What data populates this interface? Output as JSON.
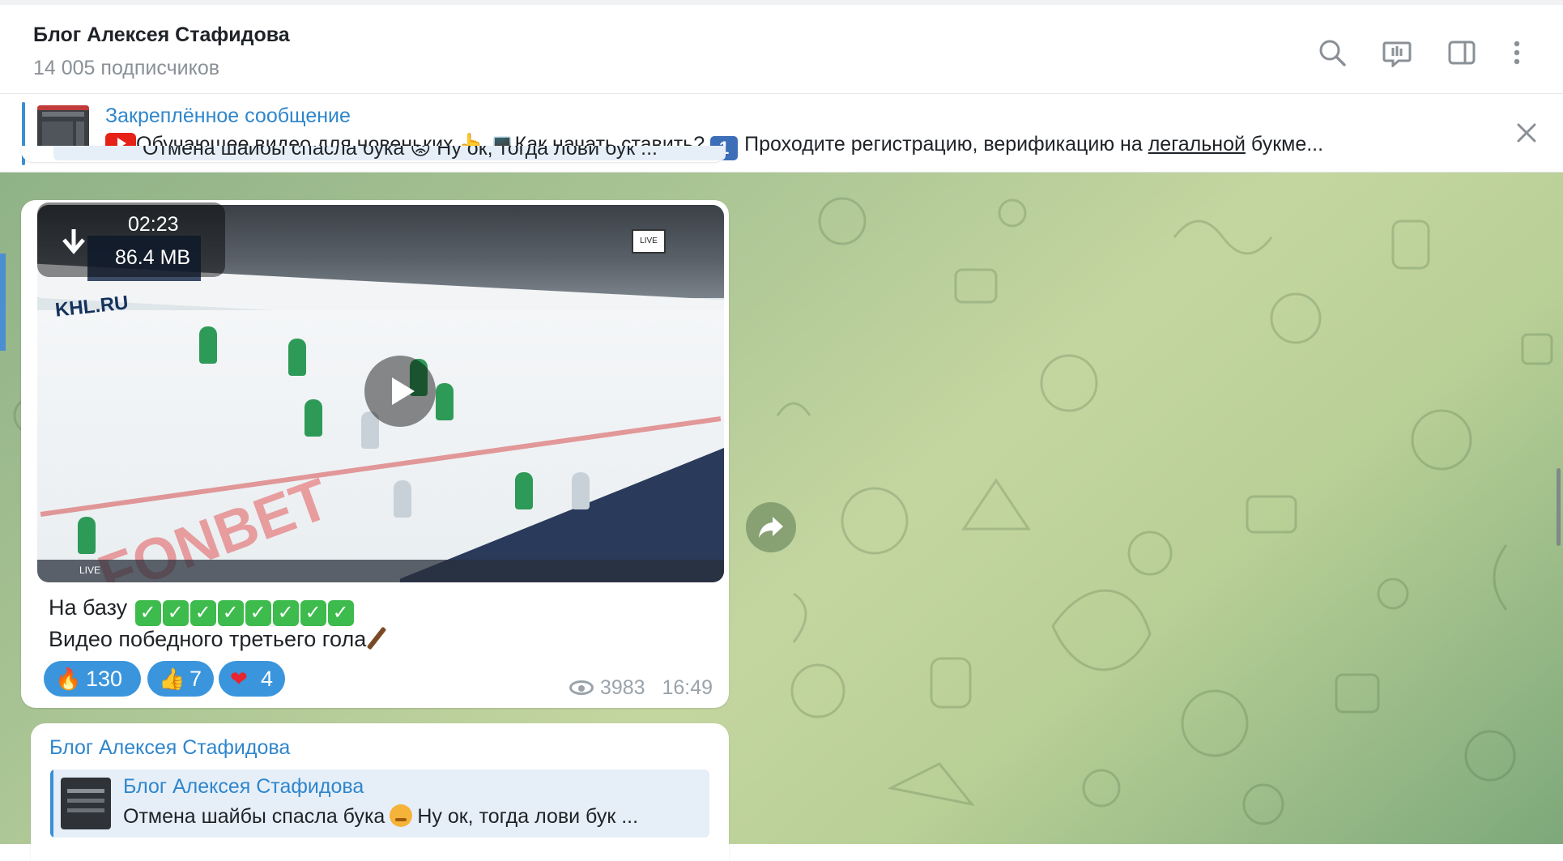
{
  "header": {
    "title": "Блог Алексея Стафидова",
    "subtitle": "14 005 подписчиков",
    "icons": [
      "search-icon",
      "discussion-icon",
      "sidebar-icon",
      "more-icon"
    ]
  },
  "pinned": {
    "label": "Закреплённое сообщение",
    "text_part1": "Обучающее видео для новеньких 👆 💻Как начать ставить?",
    "num_badge": "1",
    "text_part2": "Проходите регистрацию, верификацию на",
    "text_link": "легальной",
    "text_part3": "букме..."
  },
  "top_stub": {
    "text": "Отмена  шайбы спасла бука 😡  Ну ок, тогда лови бук ..."
  },
  "video_message": {
    "duration": "02:23",
    "size": "86.4 MB",
    "line1": "На базу",
    "line2": "Видео победного третьего гола",
    "reactions": [
      {
        "emoji": "🔥",
        "count": "130"
      },
      {
        "emoji": "👍",
        "count": "7"
      },
      {
        "emoji": "❤",
        "count": "4"
      }
    ],
    "views": "3983",
    "time": "16:49"
  },
  "reply_message": {
    "sender": "Блог Алексея Стафидова",
    "reply_name": "Блог Алексея Стафидова",
    "reply_text_part1": "Отмена  шайбы спасла бука",
    "reply_text_part2": "Ну ок, тогда лови бук ..."
  },
  "colors": {
    "accent": "#3a8fd6",
    "reaction_bg": "#3a95dc",
    "chat_bg": "#b8cf96"
  }
}
